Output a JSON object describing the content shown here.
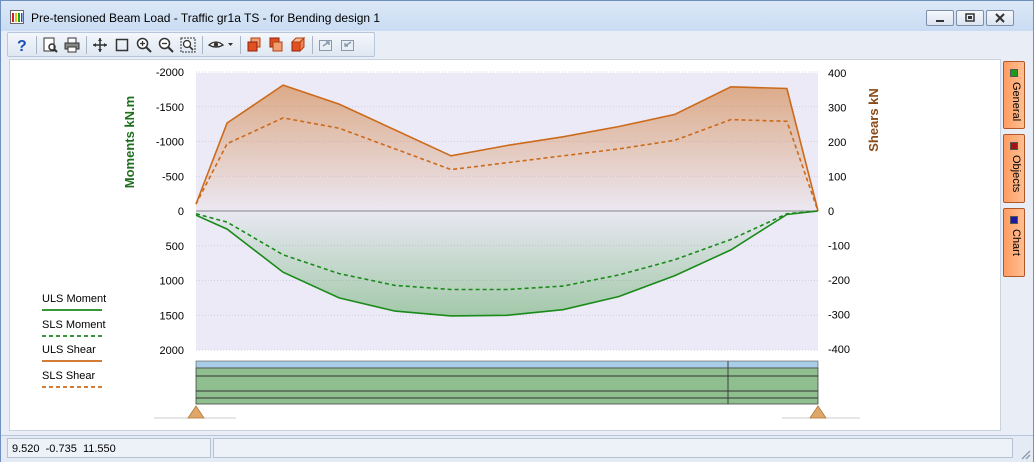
{
  "window": {
    "title": "Pre-tensioned Beam Load - Traffic gr1a TS - for Bending design 1",
    "controls": [
      "minimize",
      "restore",
      "close"
    ]
  },
  "toolbar": {
    "buttons": [
      {
        "name": "help-button",
        "icon": "question-icon"
      },
      {
        "name": "print-preview-button",
        "icon": "print-preview-icon"
      },
      {
        "name": "print-button",
        "icon": "printer-icon"
      },
      {
        "name": "pan-button",
        "icon": "move-arrows-icon"
      },
      {
        "name": "zoom-window-button",
        "icon": "rectangle-icon"
      },
      {
        "name": "zoom-in-button",
        "icon": "zoom-in-icon"
      },
      {
        "name": "zoom-out-button",
        "icon": "zoom-out-icon"
      },
      {
        "name": "zoom-extents-button",
        "icon": "zoom-extents-icon"
      },
      {
        "name": "view-dropdown-button",
        "icon": "eye-icon"
      },
      {
        "name": "view-front-button",
        "icon": "cube-front-icon"
      },
      {
        "name": "view-side-button",
        "icon": "cube-side-icon"
      },
      {
        "name": "view-3d-button",
        "icon": "cube-3d-icon"
      },
      {
        "name": "export-button",
        "icon": "export-icon"
      },
      {
        "name": "import-button",
        "icon": "import-icon"
      }
    ]
  },
  "side_tabs": [
    {
      "label": "General",
      "color": "#1a9b1a"
    },
    {
      "label": "Objects",
      "color": "#a01414"
    },
    {
      "label": "Chart",
      "color": "#1a1aa0"
    }
  ],
  "status": {
    "coordinates": "9.520  -0.735  11.550"
  },
  "colors": {
    "moment": "#1a8a1a",
    "shear": "#cc6a1a",
    "moment_axis_label": "#1f6e1f",
    "shear_axis_label": "#8b4a16",
    "plot_band": "#eceaf6",
    "beam_fill": "#8fbf8f",
    "beam_top": "#a9cde6",
    "support": "#e0a868"
  },
  "chart_data": {
    "type": "line",
    "x": [
      0,
      0.05,
      0.14,
      0.23,
      0.32,
      0.41,
      0.5,
      0.59,
      0.68,
      0.77,
      0.86,
      0.95,
      1.0
    ],
    "left_axis": {
      "label": "Moments  kN.m",
      "ticks": [
        -2000,
        -1500,
        -1000,
        -500,
        0,
        500,
        1000,
        1500,
        2000
      ],
      "range": [
        -2000,
        2000
      ],
      "inverted": true
    },
    "right_axis": {
      "label": "Shears  kN",
      "ticks": [
        400,
        300,
        200,
        100,
        0,
        -100,
        -200,
        -300,
        -400
      ],
      "range": [
        -400,
        400
      ]
    },
    "series": [
      {
        "name": "ULS Moment",
        "axis": "left",
        "dash": false,
        "points": [
          [
            0.0,
            60
          ],
          [
            0.05,
            260
          ],
          [
            0.14,
            880
          ],
          [
            0.23,
            1250
          ],
          [
            0.32,
            1440
          ],
          [
            0.41,
            1510
          ],
          [
            0.5,
            1500
          ],
          [
            0.59,
            1420
          ],
          [
            0.68,
            1230
          ],
          [
            0.77,
            930
          ],
          [
            0.86,
            560
          ],
          [
            0.95,
            50
          ],
          [
            1.0,
            0
          ]
        ]
      },
      {
        "name": "SLS Moment",
        "axis": "left",
        "dash": true,
        "points": [
          [
            0.0,
            40
          ],
          [
            0.05,
            160
          ],
          [
            0.14,
            630
          ],
          [
            0.23,
            900
          ],
          [
            0.32,
            1070
          ],
          [
            0.41,
            1130
          ],
          [
            0.5,
            1130
          ],
          [
            0.59,
            1080
          ],
          [
            0.68,
            920
          ],
          [
            0.77,
            700
          ],
          [
            0.86,
            410
          ],
          [
            0.95,
            40
          ],
          [
            1.0,
            0
          ]
        ]
      },
      {
        "name": "ULS Shear",
        "axis": "right",
        "dash": false,
        "points": [
          [
            0.0,
            20
          ],
          [
            0.05,
            255
          ],
          [
            0.14,
            365
          ],
          [
            0.23,
            310
          ],
          [
            0.41,
            160
          ],
          [
            0.5,
            190
          ],
          [
            0.59,
            215
          ],
          [
            0.68,
            245
          ],
          [
            0.77,
            280
          ],
          [
            0.86,
            360
          ],
          [
            0.95,
            355
          ],
          [
            1.0,
            0
          ]
        ]
      },
      {
        "name": "SLS Shear",
        "axis": "right",
        "dash": true,
        "points": [
          [
            0.0,
            20
          ],
          [
            0.05,
            195
          ],
          [
            0.14,
            270
          ],
          [
            0.23,
            240
          ],
          [
            0.41,
            120
          ],
          [
            0.5,
            140
          ],
          [
            0.59,
            160
          ],
          [
            0.68,
            180
          ],
          [
            0.77,
            205
          ],
          [
            0.86,
            265
          ],
          [
            0.95,
            260
          ],
          [
            1.0,
            0
          ]
        ]
      }
    ],
    "legend_position": "bottom-left",
    "grid": true
  }
}
